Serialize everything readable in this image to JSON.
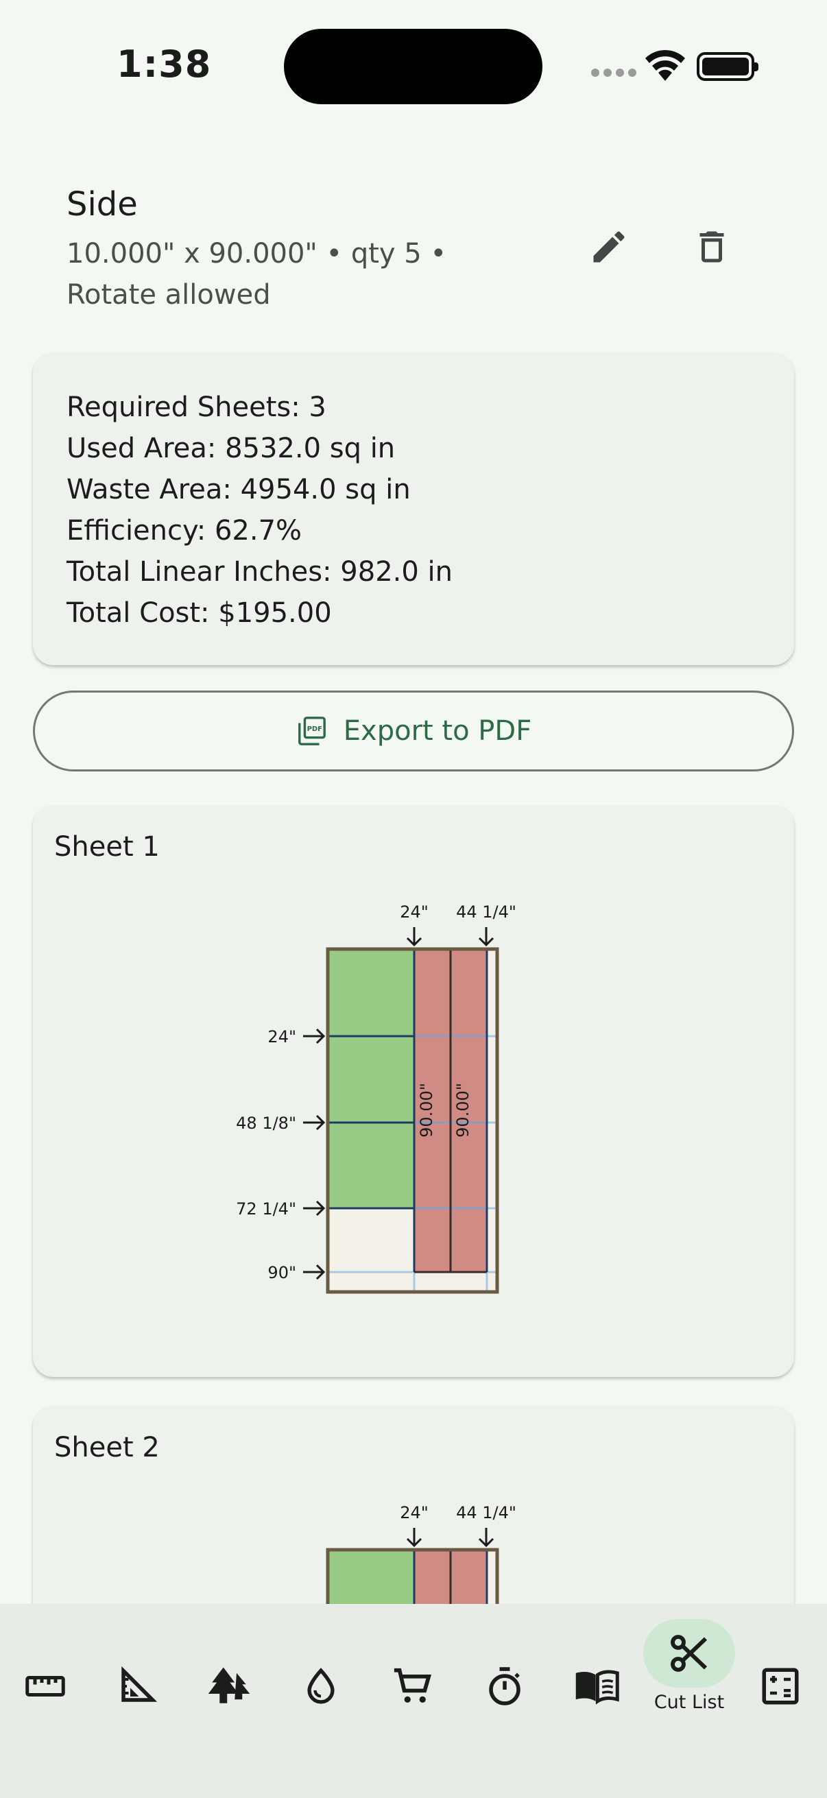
{
  "status_bar": {
    "time": "1:38"
  },
  "part": {
    "name": "Side",
    "dimensions": "10.000\" x 90.000\" • qty 5 •",
    "rotate": "Rotate allowed",
    "edit_icon": "pencil-icon",
    "delete_icon": "trash-icon"
  },
  "summary": {
    "required_sheets": "Required Sheets: 3",
    "used_area": "Used Area: 8532.0 sq in",
    "waste_area": "Waste Area: 4954.0 sq in",
    "efficiency": "Efficiency: 62.7%",
    "linear_inches": "Total Linear Inches: 982.0 in",
    "total_cost": "Total Cost: $195.00"
  },
  "export": {
    "label": "Export to PDF",
    "icon": "pdf-icon"
  },
  "sheets": [
    {
      "title": "Sheet 1",
      "top_marks": [
        "24\"",
        "44 1/4\""
      ],
      "side_marks": [
        "24\"",
        "48 1/8\"",
        "72 1/4\"",
        "90\""
      ],
      "strip_labels": [
        "90.00\"",
        "90.00\""
      ]
    },
    {
      "title": "Sheet 2",
      "top_marks": [
        "24\"",
        "44 1/4\""
      ]
    }
  ],
  "colors": {
    "accent": "#2e6a45",
    "part_green": "#97cb86",
    "part_red": "#d18b85",
    "offcut": "#f4f1e8",
    "sheet_border": "#6b5a43",
    "cut_line": "#1f3b5f",
    "cut_line_light": "#a7cbe6"
  },
  "nav": {
    "items": [
      {
        "icon": "ruler-icon"
      },
      {
        "icon": "set-square-icon"
      },
      {
        "icon": "trees-icon"
      },
      {
        "icon": "water-drop-icon"
      },
      {
        "icon": "cart-icon"
      },
      {
        "icon": "stopwatch-icon"
      },
      {
        "icon": "book-icon"
      },
      {
        "icon": "scissors-icon",
        "label": "Cut List",
        "active": true
      },
      {
        "icon": "calculator-icon"
      }
    ]
  }
}
